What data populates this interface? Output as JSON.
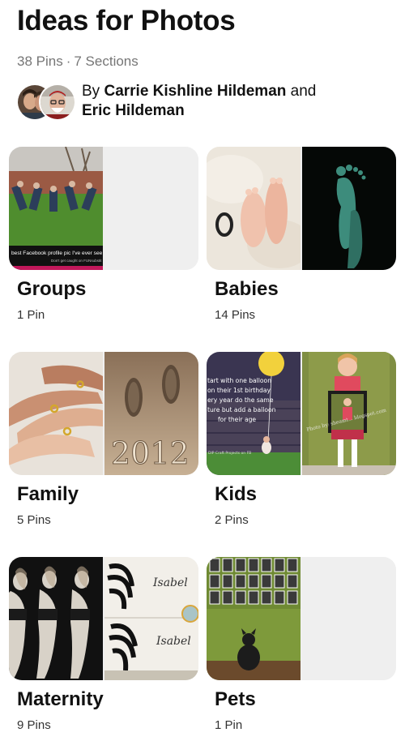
{
  "board": {
    "title": "Ideas for Photos",
    "pin_count": "38 Pins",
    "separator": "·",
    "section_count": "7 Sections",
    "by_label": "By",
    "owner": "Carrie Kishline Hildeman",
    "and_label": "and",
    "collaborator": "Eric Hildeman"
  },
  "sections": [
    {
      "name": "Groups",
      "count": "1 Pin",
      "caption": "best Facebook profile pic I've ever see",
      "subcaption": "Don't get caught on FUNsubstit"
    },
    {
      "name": "Babies",
      "count": "14 Pins"
    },
    {
      "name": "Family",
      "count": "5 Pins",
      "year_text": "2012"
    },
    {
      "name": "Kids",
      "count": "2 Pins",
      "balloon_lines": [
        "tart with one balloon",
        "on their 1st birthday",
        "ery year do the same",
        "ture but add a balloon",
        "for their age"
      ],
      "balloon_credit": "DIP Craft Projects on FB",
      "watermark": "Photo by: sheamt... blogspot.com"
    },
    {
      "name": "Maternity",
      "count": "9 Pins",
      "name_tag_1": "Isabel",
      "name_tag_2": "Isabel"
    },
    {
      "name": "Pets",
      "count": "1 Pin"
    }
  ],
  "icons": {
    "avatar1": "avatar-photo",
    "avatar2": "avatar-photo"
  }
}
